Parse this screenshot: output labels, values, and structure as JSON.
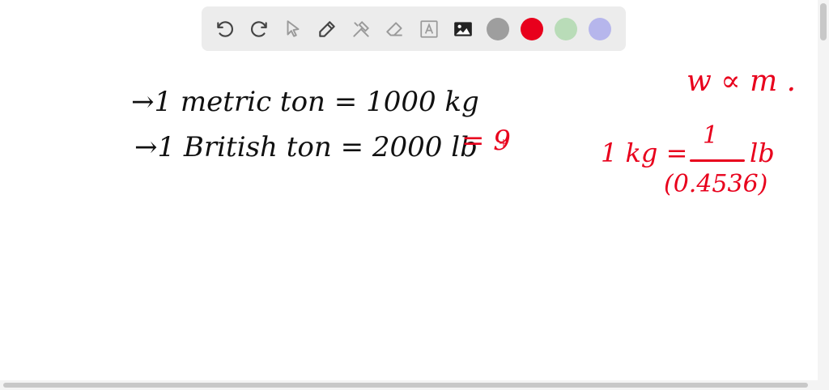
{
  "toolbar": {
    "tools": [
      {
        "name": "undo-icon"
      },
      {
        "name": "redo-icon"
      },
      {
        "name": "select-pointer-icon"
      },
      {
        "name": "pen-icon"
      },
      {
        "name": "tools-icon"
      },
      {
        "name": "eraser-icon"
      },
      {
        "name": "text-box-icon"
      },
      {
        "name": "image-icon"
      }
    ],
    "colors": [
      "#9e9e9e",
      "#e8001c",
      "#b9dcb8",
      "#b6b6ec"
    ]
  },
  "canvas": {
    "line1": "→1 metric  ton = 1000 kg",
    "line2": "→1 British  ton = 2000 lb",
    "line2_red": "= 9",
    "proportion": "w ∝ m .",
    "kg_lhs": "1 kg =",
    "frac_numerator": "1",
    "frac_denominator": "(0.4536)",
    "lb_rhs": "lb"
  }
}
